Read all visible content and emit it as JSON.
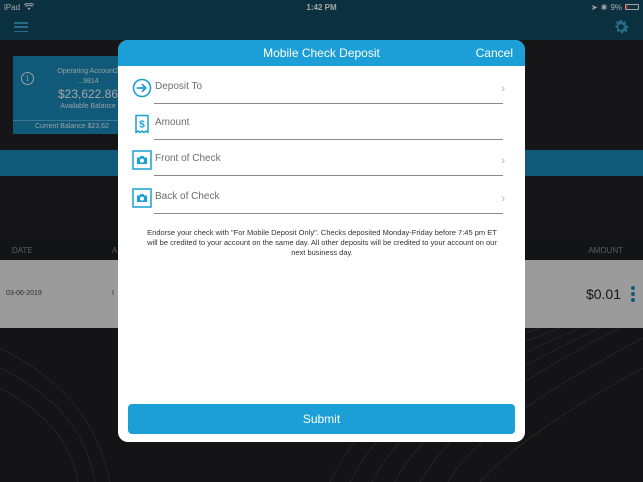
{
  "status_bar": {
    "carrier": "iPad",
    "time": "1:42 PM",
    "battery": "9%"
  },
  "background": {
    "account": {
      "name": "Operating Account2",
      "number": "...9814",
      "balance": "$23,622.86",
      "available_label": "Available Balance",
      "current_balance": "Current Balance $23,62"
    },
    "table": {
      "col_date": "DATE",
      "col_a": "A",
      "col_amount": "AMOUNT",
      "row": {
        "date": "03-06-2019",
        "mid": "I",
        "amount": "$0.01"
      }
    }
  },
  "modal": {
    "title": "Mobile Check Deposit",
    "cancel": "Cancel",
    "fields": [
      {
        "label": "Deposit To",
        "icon": "arrow-right-circle-icon",
        "has_chevron": true
      },
      {
        "label": "Amount",
        "icon": "dollar-receipt-icon",
        "has_chevron": false
      },
      {
        "label": "Front of Check",
        "icon": "camera-icon",
        "has_chevron": true
      },
      {
        "label": "Back of Check",
        "icon": "camera-icon",
        "has_chevron": true
      }
    ],
    "disclaimer": "Endorse your check with \"For Mobile Deposit Only\". Checks deposited Monday-Friday before 7:45 pm ET will be credited to your account on the same day. All other deposits will be credited to your account on our next business day.",
    "submit": "Submit"
  },
  "colors": {
    "accent": "#1b9fd6",
    "nav": "#124a63"
  }
}
